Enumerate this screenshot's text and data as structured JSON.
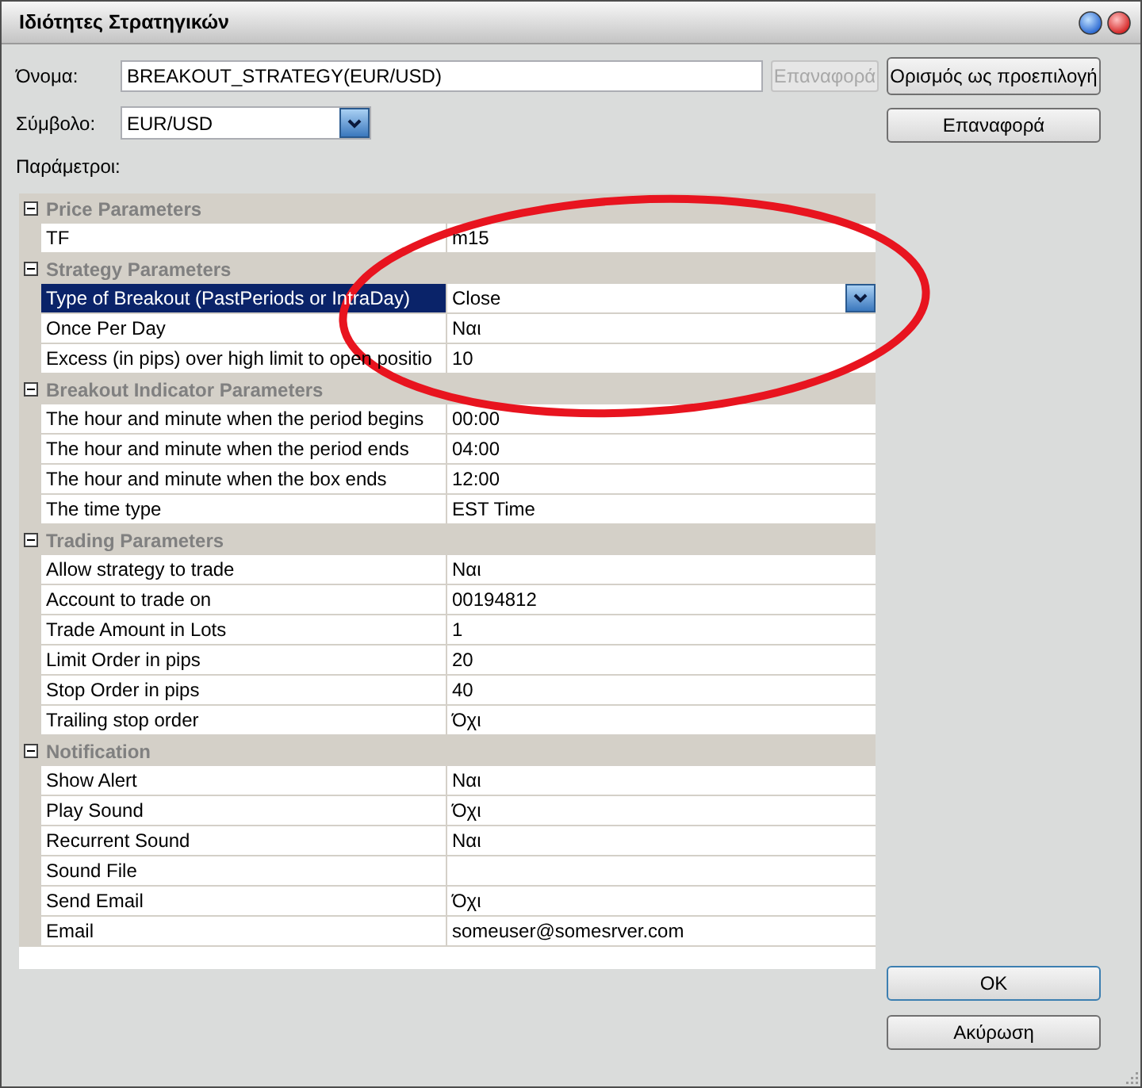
{
  "window": {
    "title": "Ιδιότητες Στρατηγικών"
  },
  "name_field": {
    "label": "Όνομα:",
    "value": "BREAKOUT_STRATEGY(EUR/USD)"
  },
  "name_reset_button": {
    "label": "Επαναφορά",
    "disabled": true
  },
  "symbol_field": {
    "label": "Σύμβολο:",
    "value": "EUR/USD"
  },
  "side_buttons": [
    {
      "label": "Ορισμός ως προεπιλογή"
    },
    {
      "label": "Επαναφορά"
    }
  ],
  "parameters_label": "Παράμετροι:",
  "property_grid": {
    "categories": [
      {
        "title": "Price Parameters",
        "expanded": true,
        "properties": [
          {
            "name": "TF",
            "value": "m15",
            "selected": false
          }
        ]
      },
      {
        "title": "Strategy Parameters",
        "expanded": true,
        "properties": [
          {
            "name": "Type of Breakout (PastPeriods or IntraDay)",
            "value": "Close",
            "selected": true
          },
          {
            "name": "Once Per Day",
            "value": "Ναι",
            "selected": false
          },
          {
            "name": "Excess (in pips) over high limit to open positio",
            "value": "10",
            "selected": false
          }
        ]
      },
      {
        "title": "Breakout Indicator Parameters",
        "expanded": true,
        "properties": [
          {
            "name": "The hour and minute when the period begins",
            "value": "00:00",
            "selected": false
          },
          {
            "name": "The hour and minute when the period ends",
            "value": "04:00",
            "selected": false
          },
          {
            "name": "The hour and minute when the box ends",
            "value": "12:00",
            "selected": false
          },
          {
            "name": "The time type",
            "value": "EST Time",
            "selected": false
          }
        ]
      },
      {
        "title": "Trading Parameters",
        "expanded": true,
        "properties": [
          {
            "name": "Allow strategy to trade",
            "value": "Ναι",
            "selected": false
          },
          {
            "name": "Account to trade on",
            "value": "00194812",
            "selected": false
          },
          {
            "name": "Trade Amount in Lots",
            "value": "1",
            "selected": false
          },
          {
            "name": "Limit Order in pips",
            "value": "20",
            "selected": false
          },
          {
            "name": "Stop Order in pips",
            "value": "40",
            "selected": false
          },
          {
            "name": "Trailing stop order",
            "value": "Όχι",
            "selected": false
          }
        ]
      },
      {
        "title": "Notification",
        "expanded": true,
        "properties": [
          {
            "name": "Show Alert",
            "value": "Ναι",
            "selected": false
          },
          {
            "name": "Play Sound",
            "value": "Όχι",
            "selected": false
          },
          {
            "name": "Recurrent Sound",
            "value": "Ναι",
            "selected": false
          },
          {
            "name": "Sound File",
            "selected": false
          },
          {
            "name": "Send Email",
            "value": "Όχι",
            "selected": false
          },
          {
            "name": "Email",
            "value": "someuser@somesrver.com",
            "selected": false
          }
        ]
      }
    ]
  },
  "dialog_buttons": [
    {
      "label": "OK",
      "default": true
    },
    {
      "label": "Ακύρωση",
      "default": false
    }
  ],
  "annotations": [
    {
      "kind": "ellipse"
    }
  ]
}
